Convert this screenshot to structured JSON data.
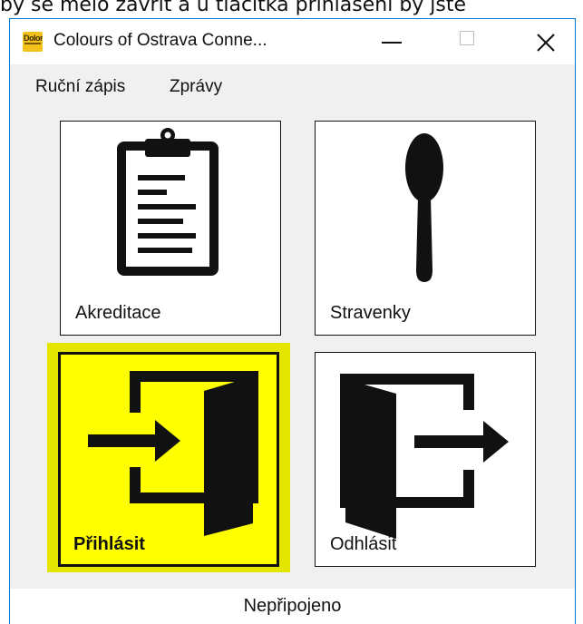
{
  "background_text": "by se mělo zavřít a u tlačítka přihlášení by jste",
  "window": {
    "title": "Colours of Ostrava Conne...",
    "app_icon": "colours-of-ostrava-logo",
    "controls": {
      "minimize_icon": "minimize-icon",
      "maximize_icon": "maximize-icon",
      "close_icon": "close-icon"
    }
  },
  "menu": {
    "items": [
      {
        "label": "Ruční zápis"
      },
      {
        "label": "Zprávy"
      }
    ]
  },
  "tiles": [
    {
      "label": "Akreditace",
      "icon": "clipboard-icon",
      "selected": false
    },
    {
      "label": "Stravenky",
      "icon": "spoon-icon",
      "selected": false
    },
    {
      "label": "Přihlásit",
      "icon": "login-door-icon",
      "selected": true
    },
    {
      "label": "Odhlásit",
      "icon": "logout-door-icon",
      "selected": false
    }
  ],
  "status": {
    "text": "Nepřipojeno"
  },
  "colors": {
    "selected_tile": "#ffff00",
    "selected_frame": "#e5e600",
    "window_border": "#0078d7",
    "window_bg": "#f0f0f0"
  }
}
